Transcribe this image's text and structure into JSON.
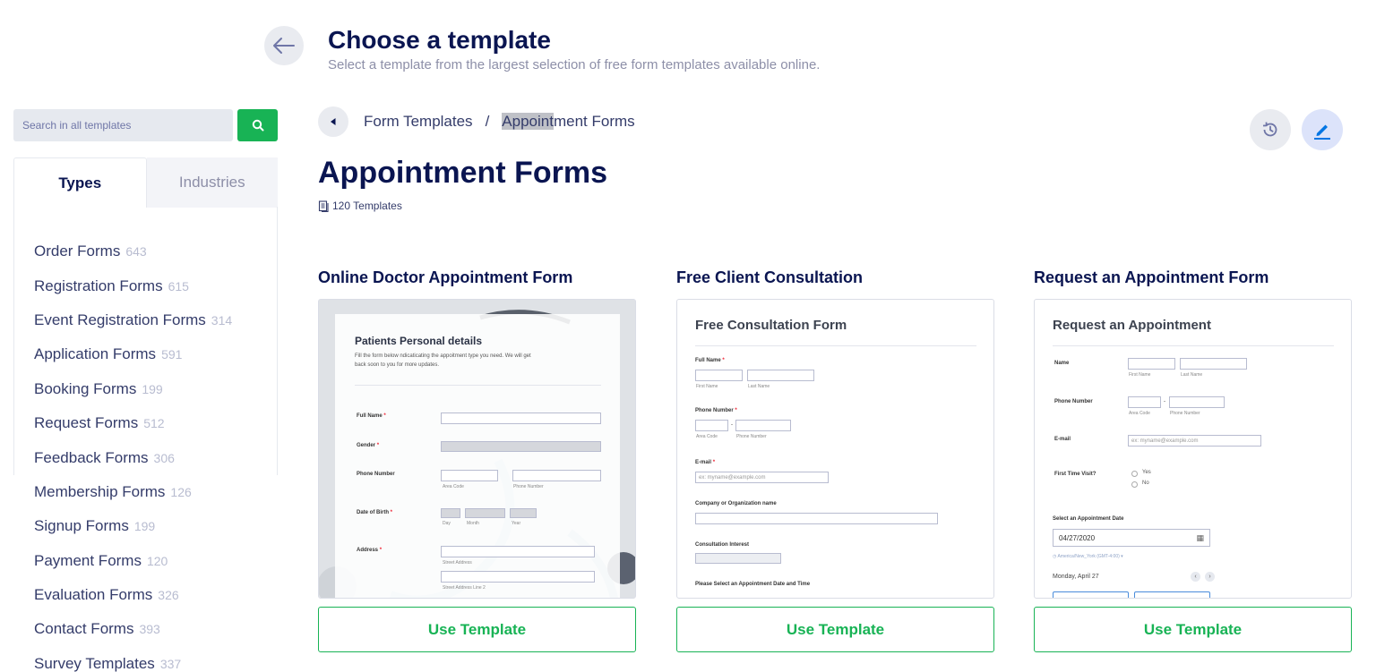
{
  "header": {
    "title": "Choose a template",
    "subtitle": "Select a template from the largest selection of free form templates available online."
  },
  "search": {
    "placeholder": "Search in all templates"
  },
  "tabs": {
    "types": "Types",
    "industries": "Industries"
  },
  "categories": [
    {
      "label": "Order Forms",
      "count": "643"
    },
    {
      "label": "Registration Forms",
      "count": "615"
    },
    {
      "label": "Event Registration Forms",
      "count": "314"
    },
    {
      "label": "Application Forms",
      "count": "591"
    },
    {
      "label": "Booking Forms",
      "count": "199"
    },
    {
      "label": "Request Forms",
      "count": "512"
    },
    {
      "label": "Feedback Forms",
      "count": "306"
    },
    {
      "label": "Membership Forms",
      "count": "126"
    },
    {
      "label": "Signup Forms",
      "count": "199"
    },
    {
      "label": "Payment Forms",
      "count": "120"
    },
    {
      "label": "Evaluation Forms",
      "count": "326"
    },
    {
      "label": "Contact Forms",
      "count": "393"
    },
    {
      "label": "Survey Templates",
      "count": "337"
    }
  ],
  "breadcrumb": {
    "root": "Form Templates",
    "separator": "/",
    "current_highlight": "Appoint",
    "current_rest": "ment Forms"
  },
  "section": {
    "title": "Appointment Forms",
    "count_text": "120 Templates"
  },
  "cards": [
    {
      "title": "Online Doctor Appointment Form",
      "button": "Use Template",
      "preview": {
        "heading": "Patients Personal details",
        "desc1": "Fill the form below ndicaticating the appoitment type you need. We will get",
        "desc2": "back soon to you for more updates.",
        "full_name": "Full Name",
        "gender": "Gender",
        "phone": "Phone Number",
        "area_code": "Area Code",
        "phone_sub": "Phone Number",
        "dob": "Date of Birth",
        "day": "Day",
        "month": "Month",
        "year": "Year",
        "address": "Address",
        "street": "Street Address",
        "street2": "Street Address Line 2",
        "req": "*"
      }
    },
    {
      "title": "Free Client Consultation",
      "button": "Use Template",
      "preview": {
        "heading": "Free Consultation Form",
        "full_name": "Full Name",
        "first": "First Name",
        "last": "Last Name",
        "phone": "Phone Number",
        "area_code": "Area Code",
        "phone_sub": "Phone Number",
        "email": "E-mail",
        "email_ph": "ex: myname@example.com",
        "company": "Company or Organization name",
        "interest": "Consultation Interest",
        "select_date": "Please Select an Appointment Date and Time",
        "req": "*"
      }
    },
    {
      "title": "Request an Appointment Form",
      "button": "Use Template",
      "preview": {
        "heading": "Request an Appointment",
        "name": "Name",
        "first": "First Name",
        "last": "Last Name",
        "phone": "Phone Number",
        "area_code": "Area Code",
        "phone_sub": "Phone Number",
        "email": "E-mail",
        "email_ph": "ex: myname@example.com",
        "first_visit": "First Time Visit?",
        "yes": "Yes",
        "no": "No",
        "select_date": "Select an Appointment Date",
        "date_value": "04/27/2020",
        "timezone": "America/New_York (GMT-4:00) ▾",
        "day_label": "Monday, April 27"
      }
    }
  ],
  "colors": {
    "brand_green": "#18b355",
    "navy": "#0a1551",
    "muted": "#8d8fa8"
  }
}
